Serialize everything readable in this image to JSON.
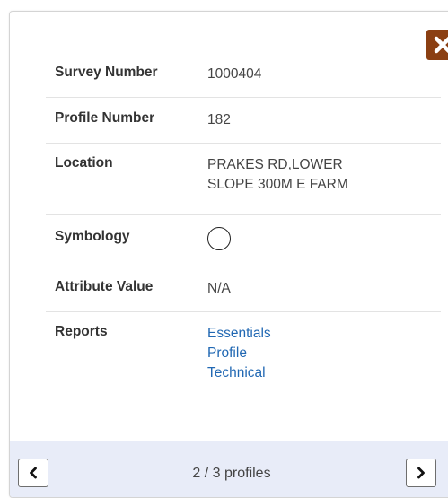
{
  "popup": {
    "close_icon": "close-x-icon",
    "rows": [
      {
        "label": "Survey Number",
        "value": "1000404"
      },
      {
        "label": "Profile Number",
        "value": "182"
      },
      {
        "label": "Location",
        "value_lines": [
          "PRAKES RD,LOWER",
          "SLOPE 300M E FARM"
        ]
      },
      {
        "label": "Symbology",
        "symbol": "circle-outline"
      },
      {
        "label": "Attribute Value",
        "value": "N/A"
      },
      {
        "label": "Reports",
        "links": [
          "Essentials",
          "Profile",
          "Technical"
        ]
      }
    ]
  },
  "footer": {
    "prev_icon": "chevron-left-icon",
    "next_icon": "chevron-right-icon",
    "page_text": "2 / 3 profiles"
  },
  "colors": {
    "close_button": "#8b3f12",
    "link": "#2168b3",
    "footer_bg": "#e8ecf8"
  }
}
